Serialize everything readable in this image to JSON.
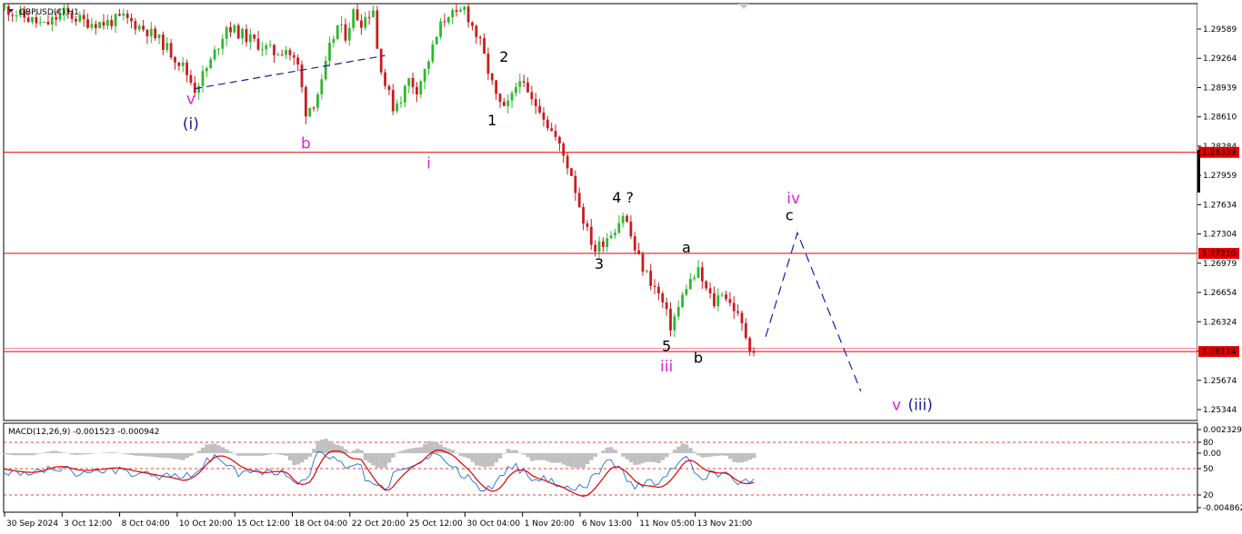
{
  "window": {
    "symbol_label": "GBPUSD(€),H1",
    "indicator_label": "MACD(12,26,9) -0.001523 -0.000942"
  },
  "colors": {
    "background": "#ffffff",
    "grid_border": "#000000",
    "bull_candle": "#2eb82e",
    "bear_candle": "#c81e1e",
    "level_line": "#e00000",
    "magenta_label": "#e020e0",
    "navy_label": "#1a1aa0",
    "projection_line": "#1a1ab0",
    "macd_hist": "#c0c0c0",
    "macd_signal": "#e00000",
    "macd_line": "#1e6fd9"
  },
  "chart_data": [
    {
      "type": "candlestick",
      "title": "GBPUSD(€),H1",
      "ylim": [
        1.25344,
        1.3
      ],
      "y_ticks": [
        "1.29589",
        "1.29264",
        "1.28939",
        "1.28610",
        "1.28284",
        "1.27959",
        "1.27634",
        "1.27304",
        "1.26979",
        "1.26654",
        "1.26324",
        "1.25999",
        "1.25674",
        "1.25344"
      ],
      "x_ticks": [
        "30 Sep 2024",
        "3 Oct 12:00",
        "8 Oct 04:00",
        "10 Oct 20:00",
        "15 Oct 12:00",
        "18 Oct 04:00",
        "22 Oct 20:00",
        "25 Oct 12:00",
        "30 Oct 04:00",
        "1 Nov 20:00",
        "6 Nov 13:00",
        "11 Nov 05:00",
        "13 Nov 21:00"
      ],
      "price_path": [
        [
          0,
          1.2995
        ],
        [
          5,
          1.2985
        ],
        [
          10,
          1.2975
        ],
        [
          15,
          1.299
        ],
        [
          20,
          1.298
        ],
        [
          25,
          1.2978
        ],
        [
          30,
          1.2984
        ],
        [
          36,
          1.297
        ],
        [
          40,
          1.2955
        ],
        [
          45,
          1.293
        ],
        [
          48,
          1.2905
        ],
        [
          52,
          1.2935
        ],
        [
          56,
          1.2975
        ],
        [
          60,
          1.2965
        ],
        [
          64,
          1.2955
        ],
        [
          68,
          1.2945
        ],
        [
          71,
          1.295
        ],
        [
          74,
          1.293
        ],
        [
          76,
          1.288
        ],
        [
          78,
          1.289
        ],
        [
          80,
          1.291
        ],
        [
          82,
          1.295
        ],
        [
          84,
          1.2975
        ],
        [
          86,
          1.2965
        ],
        [
          88,
          1.299
        ],
        [
          90,
          1.298
        ],
        [
          93,
          1.2995
        ],
        [
          94,
          1.295
        ],
        [
          96,
          1.291
        ],
        [
          98,
          1.2885
        ],
        [
          100,
          1.2895
        ],
        [
          102,
          1.2915
        ],
        [
          104,
          1.2905
        ],
        [
          106,
          1.2925
        ],
        [
          108,
          1.295
        ],
        [
          110,
          1.2975
        ],
        [
          112,
          1.299
        ],
        [
          114,
          1.2985
        ],
        [
          116,
          1.2995
        ],
        [
          118,
          1.2975
        ],
        [
          120,
          1.2955
        ],
        [
          122,
          1.2925
        ],
        [
          124,
          1.2895
        ],
        [
          126,
          1.288
        ],
        [
          128,
          1.2895
        ],
        [
          130,
          1.292
        ],
        [
          131,
          1.2905
        ],
        [
          133,
          1.289
        ],
        [
          135,
          1.2885
        ],
        [
          137,
          1.2865
        ],
        [
          139,
          1.285
        ],
        [
          141,
          1.283
        ],
        [
          143,
          1.281
        ],
        [
          145,
          1.2775
        ],
        [
          147,
          1.2745
        ],
        [
          149,
          1.2725
        ],
        [
          151,
          1.2735
        ],
        [
          154,
          1.275
        ],
        [
          156,
          1.2765
        ],
        [
          157,
          1.2755
        ],
        [
          159,
          1.2725
        ],
        [
          161,
          1.2705
        ],
        [
          163,
          1.269
        ],
        [
          165,
          1.2675
        ],
        [
          166,
          1.2665
        ],
        [
          168,
          1.264
        ],
        [
          170,
          1.266
        ],
        [
          172,
          1.2685
        ],
        [
          174,
          1.2695
        ],
        [
          175,
          1.27
        ],
        [
          177,
          1.268
        ],
        [
          179,
          1.2665
        ],
        [
          181,
          1.268
        ],
        [
          183,
          1.2665
        ],
        [
          184,
          1.266
        ],
        [
          186,
          1.264
        ],
        [
          188,
          1.2618
        ],
        [
          189,
          1.2612
        ]
      ],
      "horizontal_levels": [
        {
          "price": 1.28339,
          "label": "1.28339"
        },
        {
          "price": 1.2721,
          "label": "1.27210"
        },
        {
          "price": 1.26114,
          "label": "1.26114"
        }
      ],
      "annotations": [
        {
          "text": "iii",
          "color_role": "magenta",
          "idx": -26,
          "price": 1.2964
        },
        {
          "text": "v",
          "color_role": "magenta",
          "idx": 47,
          "price": 1.2888
        },
        {
          "text": "(i)",
          "color_role": "navy",
          "idx": 47,
          "price": 1.286
        },
        {
          "text": "b",
          "color_role": "magenta",
          "idx": 76,
          "price": 1.2838
        },
        {
          "text": "i",
          "color_role": "magenta",
          "idx": 107,
          "price": 1.2816
        },
        {
          "text": "1",
          "color_role": "black",
          "idx": 123,
          "price": 1.2864
        },
        {
          "text": "2",
          "color_role": "black",
          "idx": 126,
          "price": 1.2935
        },
        {
          "text": "4 ?",
          "color_role": "black",
          "idx": 156,
          "price": 1.2778
        },
        {
          "text": "3",
          "color_role": "black",
          "idx": 150,
          "price": 1.2704
        },
        {
          "text": "a",
          "color_role": "black",
          "idx": 172,
          "price": 1.2722
        },
        {
          "text": "5",
          "color_role": "black",
          "idx": 167,
          "price": 1.2612
        },
        {
          "text": "iii",
          "color_role": "magenta",
          "idx": 167,
          "price": 1.2589
        },
        {
          "text": "b",
          "color_role": "black",
          "idx": 175,
          "price": 1.2599
        },
        {
          "text": "iv",
          "color_role": "magenta",
          "idx": 199,
          "price": 1.2777
        },
        {
          "text": "c",
          "color_role": "black",
          "idx": 198,
          "price": 1.2758
        },
        {
          "text": "v",
          "color_role": "magenta",
          "idx": 225,
          "price": 1.2546
        },
        {
          "text": "(iii)",
          "color_role": "navy",
          "idx": 231,
          "price": 1.2546
        }
      ],
      "trendline": [
        [
          48,
          1.2905
        ],
        [
          96,
          1.2942
        ]
      ],
      "projection": [
        [
          192,
          1.2628
        ],
        [
          200,
          1.2744
        ],
        [
          216,
          1.2567
        ]
      ]
    },
    {
      "type": "line",
      "title": "MACD(12,26,9) -0.001523 -0.000942",
      "y_ticks": [
        "0.002329",
        "80",
        "0.00",
        "50",
        "20",
        "-0.004862"
      ],
      "level_lines": [
        80,
        50,
        20
      ]
    }
  ]
}
